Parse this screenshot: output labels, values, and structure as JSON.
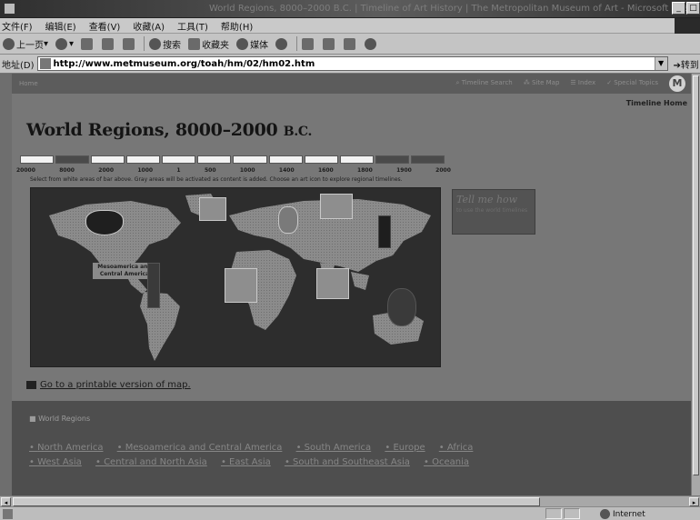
{
  "window": {
    "title": "World Regions, 8000–2000 B.C. | Timeline of Art History | The Metropolitan Museum of Art - Microsoft Internet Explorer"
  },
  "menu": [
    "文件(F)",
    "编辑(E)",
    "查看(V)",
    "收藏(A)",
    "工具(T)",
    "帮助(H)"
  ],
  "toolbar": {
    "back": "上一页",
    "search": "搜索",
    "favorites": "收藏夹",
    "media": "媒体"
  },
  "address": {
    "label": "地址(D)",
    "url": "http://www.metmuseum.org/toah/hm/02/hm02.htm",
    "go": "转到"
  },
  "site_nav": {
    "home": "Home",
    "links": [
      "Timeline Search",
      "Site Map",
      "Index",
      "Special Topics"
    ],
    "logo": "M"
  },
  "timeline_home": "Timeline Home",
  "title": {
    "main": "World Regions, 8000–2000",
    "suffix": "B.C."
  },
  "timeline": {
    "ticks": [
      "20000",
      "8000",
      "2000",
      "1000",
      "1",
      "500",
      "1000",
      "1400",
      "1600",
      "1800",
      "1900",
      "2000"
    ],
    "segments": [
      "white",
      "gray",
      "white",
      "white",
      "white",
      "white",
      "white",
      "white",
      "white",
      "white",
      "gray",
      "gray"
    ],
    "instructions": "Select from white areas of bar above. Gray areas will be activated as content is added. Choose an art icon to explore regional timelines."
  },
  "map": {
    "region_label": "Mesoamerica and Central America"
  },
  "tell_me": {
    "title": "Tell me how",
    "subtitle": "to use the world timelines"
  },
  "printable": {
    "label": "Go to a printable version of map."
  },
  "regions": {
    "heading": "World Regions",
    "links": [
      "North America",
      "Mesoamerica and Central America",
      "South America",
      "Europe",
      "Africa",
      "West Asia",
      "Central and North Asia",
      "East Asia",
      "South and Southeast Asia",
      "Oceania"
    ]
  }
}
